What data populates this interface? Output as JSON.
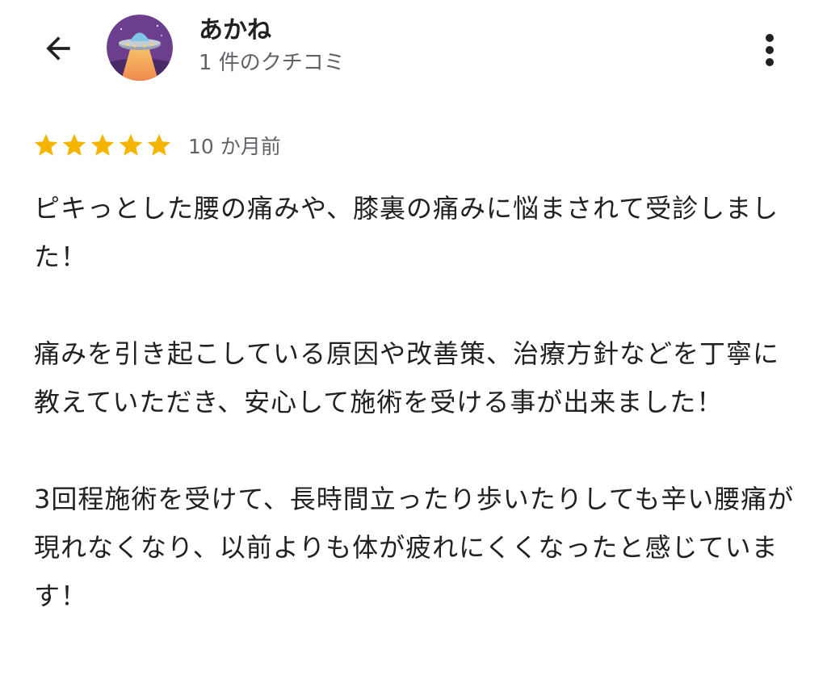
{
  "header": {
    "back_icon": "arrow-left-icon",
    "avatar_icon": "ufo-avatar-icon",
    "reviewer_name": "あかね",
    "review_count": "1 件のクチコミ",
    "more_icon": "more-vert-icon"
  },
  "review": {
    "rating": 5,
    "rating_max": 5,
    "star_color": "#F4B400",
    "date": "10 か月前",
    "paragraphs": [
      "ピキっとした腰の痛みや、膝裏の痛みに悩まされて受診しました！",
      "痛みを引き起こしている原因や改善策、治療方針などを丁寧に教えていただき、安心して施術を受ける事が出来ました！",
      "3回程施術を受けて、長時間立ったり歩いたりしても辛い腰痛が現れなくなり、以前よりも体が疲れにくくなったと感じています！"
    ]
  }
}
